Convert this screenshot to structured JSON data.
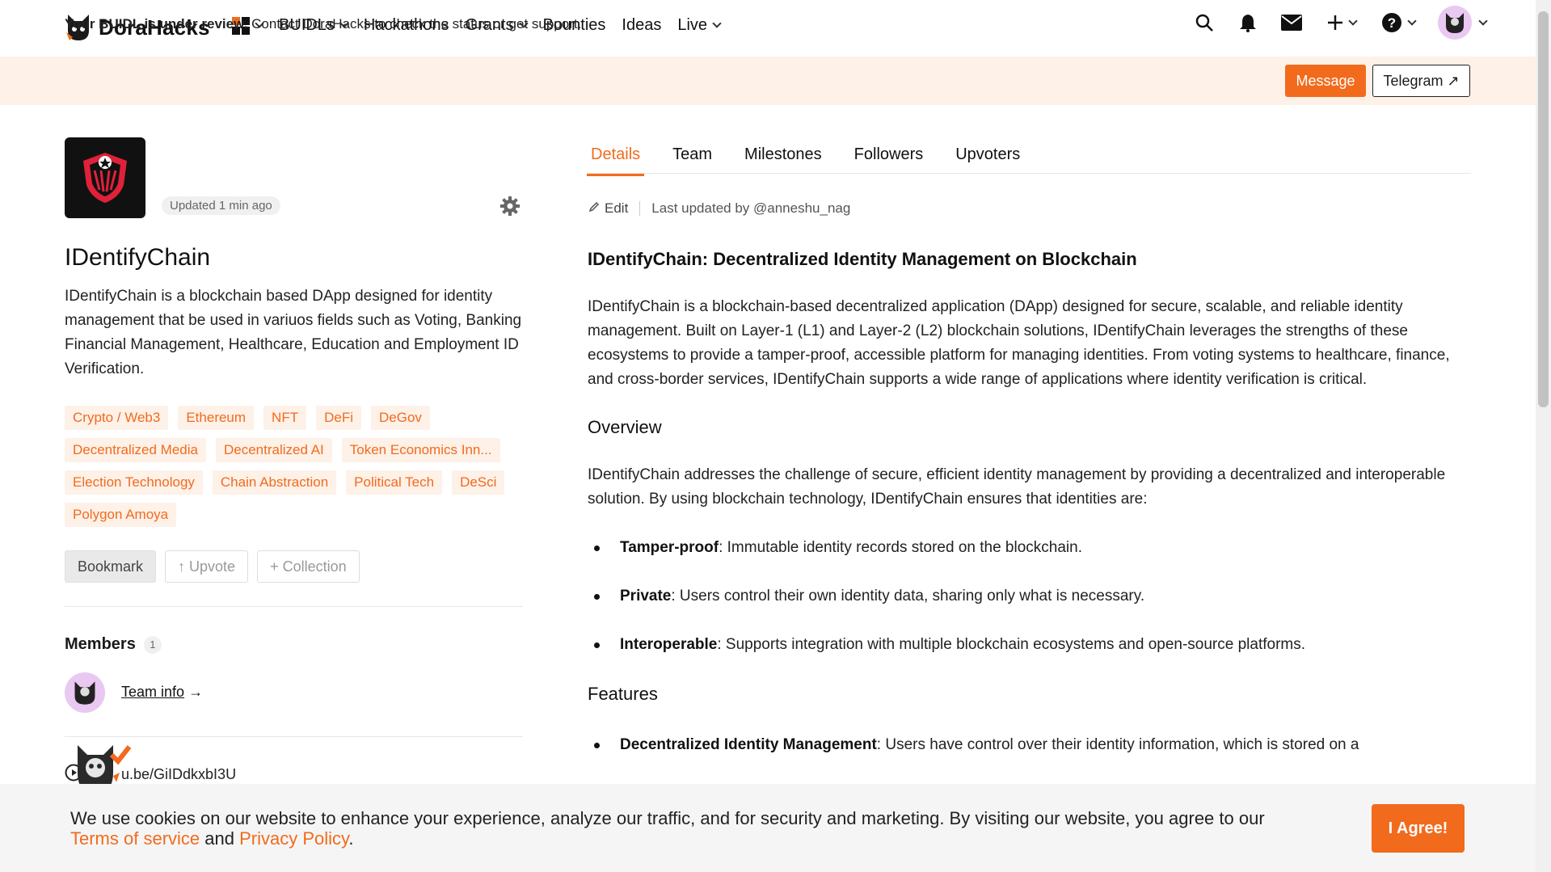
{
  "app": {
    "name": "DoraHacks"
  },
  "nav": {
    "items": [
      {
        "label": "BUIDLs",
        "dropdown": true
      },
      {
        "label": "Hackathons",
        "dropdown": false
      },
      {
        "label": "Grants",
        "dropdown": true
      },
      {
        "label": "Bounties",
        "dropdown": false
      },
      {
        "label": "Ideas",
        "dropdown": false
      },
      {
        "label": "Live",
        "dropdown": true
      }
    ],
    "right_icons": [
      "search-icon",
      "bell-icon",
      "mail-icon",
      "plus-icon",
      "help-icon",
      "user-avatar"
    ]
  },
  "banner": {
    "bold": "Your BUIDL is under review.",
    "text": " Contact DoraHacks to check the status or get support.",
    "message_label": "Message",
    "telegram_label": "Telegram ↗"
  },
  "project": {
    "updated": "Updated 1 min ago",
    "title": "IDentifyChain",
    "description": "IDentifyChain is a blockchain based DApp designed for identity management that be used in variuos fields such as Voting, Banking Financial Management, Healthcare, Education and Employment ID Verification.",
    "tags": [
      "Crypto / Web3",
      "Ethereum",
      "NFT",
      "DeFi",
      "DeGov",
      "Decentralized Media",
      "Decentralized AI",
      "Token Economics Inn...",
      "Election Technology",
      "Chain Abstraction",
      "Political Tech",
      "DeSci",
      "Polygon Amoya"
    ],
    "actions": {
      "bookmark": "Bookmark",
      "upvote": "↑ Upvote",
      "collection": "+ Collection"
    },
    "members_label": "Members",
    "members_count": "1",
    "team_info": "Team info",
    "team_info_arrow": "→",
    "video_link": "u.be/GiIDdkxbI3U"
  },
  "tabs": [
    "Details",
    "Team",
    "Milestones",
    "Followers",
    "Upvoters"
  ],
  "edit": {
    "label": "Edit",
    "last_updated": "Last updated by @anneshu_nag"
  },
  "details": {
    "heading": "IDentifyChain: Decentralized Identity Management on Blockchain",
    "intro": "IDentifyChain is a blockchain-based decentralized application (DApp) designed for secure, scalable, and reliable identity management. Built on Layer-1 (L1) and Layer-2 (L2) blockchain solutions, IDentifyChain leverages the strengths of these ecosystems to provide a tamper-proof, accessible platform for managing identities. From voting systems to healthcare, finance, and cross-border services, IDentifyChain supports a wide range of applications where identity verification is critical.",
    "overview_heading": "Overview",
    "overview_text": "IDentifyChain addresses the challenge of secure, efficient identity management by providing a decentralized and interoperable solution. By using blockchain technology, IDentifyChain ensures that identities are:",
    "bullets": [
      {
        "term": "Tamper-proof",
        "text": ": Immutable identity records stored on the blockchain."
      },
      {
        "term": "Private",
        "text": ": Users control their own identity data, sharing only what is necessary."
      },
      {
        "term": "Interoperable",
        "text": ": Supports integration with multiple blockchain ecosystems and open-source platforms."
      }
    ],
    "features_heading": "Features",
    "features": [
      {
        "term": "Decentralized Identity Management",
        "text": ": Users have control over their identity information, which is stored on a"
      }
    ]
  },
  "cookie": {
    "text_before": "We use cookies on our website to enhance your experience, analyze our traffic, and for security and marketing. By visiting our website, you agree to our ",
    "terms": "Terms of service",
    "and": " and ",
    "privacy": "Privacy Policy",
    "end": ".",
    "agree": "I Agree!"
  },
  "colors": {
    "accent": "#f26b1d",
    "banner_bg": "#fdf1e8",
    "cookie_bg": "#f5f5f5"
  }
}
